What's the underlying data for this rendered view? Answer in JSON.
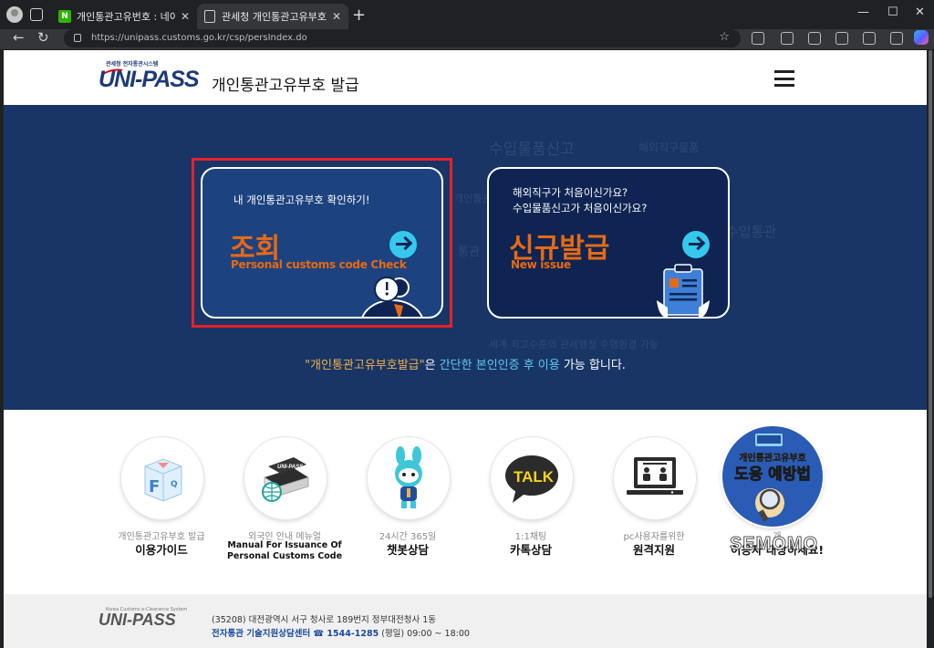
{
  "browser": {
    "tabs": [
      {
        "title": "개인통관고유번호 : 네이버 검색",
        "favicon": "naver-icon"
      },
      {
        "title": "관세청 개인통관고유부호",
        "favicon": "page-icon",
        "active": true
      }
    ],
    "url": "https://unipass.customs.go.kr/csp/persIndex.do",
    "window_controls": {
      "minimize": "—",
      "maximize": "☐",
      "close": "✕"
    }
  },
  "header": {
    "logo_small": "관세청 전자통관시스템",
    "logo_text": "UNI-PASS",
    "title": "개인통관고유부호 발급",
    "menu_icon": "hamburger-icon"
  },
  "hero": {
    "background_words": [
      "수입물품신고",
      "해외직구물품",
      "개인통관고유부호",
      "수입통관",
      "통관",
      "세계 최고수준의 관세행정 수행환경 가능"
    ],
    "lookup_card": {
      "subtitle": "내 개인통관고유부호 확인하기!",
      "title": "조회",
      "english": "Personal customs code Check",
      "icon": "customs-officer-icon"
    },
    "issue_card": {
      "subtitle_line1": "해외직구가 처음이신가요?",
      "subtitle_line2": "수입물품신고가 처음이신가요?",
      "title": "신규발급",
      "english": "New issue",
      "icon": "clipboard-document-icon"
    },
    "note": {
      "quoted": "\"개인통관고유부호발급\"",
      "particle": "은 ",
      "emphasis": "간단한 본인인증 후 이용",
      "suffix": " 가능 합니다."
    },
    "colors": {
      "background": "#183566",
      "accent_orange": "#e66a14",
      "arrow_cyan": "#35c9ee",
      "highlight_red": "#e8202a"
    }
  },
  "services": [
    {
      "caption": "개인통관고유부호 발급",
      "title": "이용가이드",
      "icon": "faq-cube-icon"
    },
    {
      "caption": "외국인 안내 메뉴얼",
      "title_line1": "Manual For Issuance Of",
      "title_line2": "Personal Customs Code",
      "icon": "manual-book-icon"
    },
    {
      "caption": "24시간 365일",
      "title": "챗봇상담",
      "icon": "chatbot-mascot-icon"
    },
    {
      "caption": "1:1채팅",
      "title": "카톡상담",
      "icon": "kakaotalk-icon",
      "icon_text": "TALK"
    },
    {
      "caption": "pc사용자를위한",
      "title": "원격지원",
      "icon": "remote-support-icon"
    },
    {
      "caption": "개",
      "title": "이용자 대상하세요!",
      "icon": "identity-theft-prevention-icon",
      "icon_text_line1": "개인통관고유부호",
      "icon_text_line2": "도용 예방법"
    }
  ],
  "watermark": "SEMOMO",
  "footer": {
    "logo_small": "Korea Customs e-Clearance System",
    "logo_text": "UNI-PASS",
    "address": "(35208) 대전광역시 서구 청사로 189번지 정부대전청사 1동",
    "center": "전자통관 기술지원상담센터",
    "phone": "☎ 1544-1285",
    "hours": "(평일) 09:00 ~ 18:00"
  }
}
